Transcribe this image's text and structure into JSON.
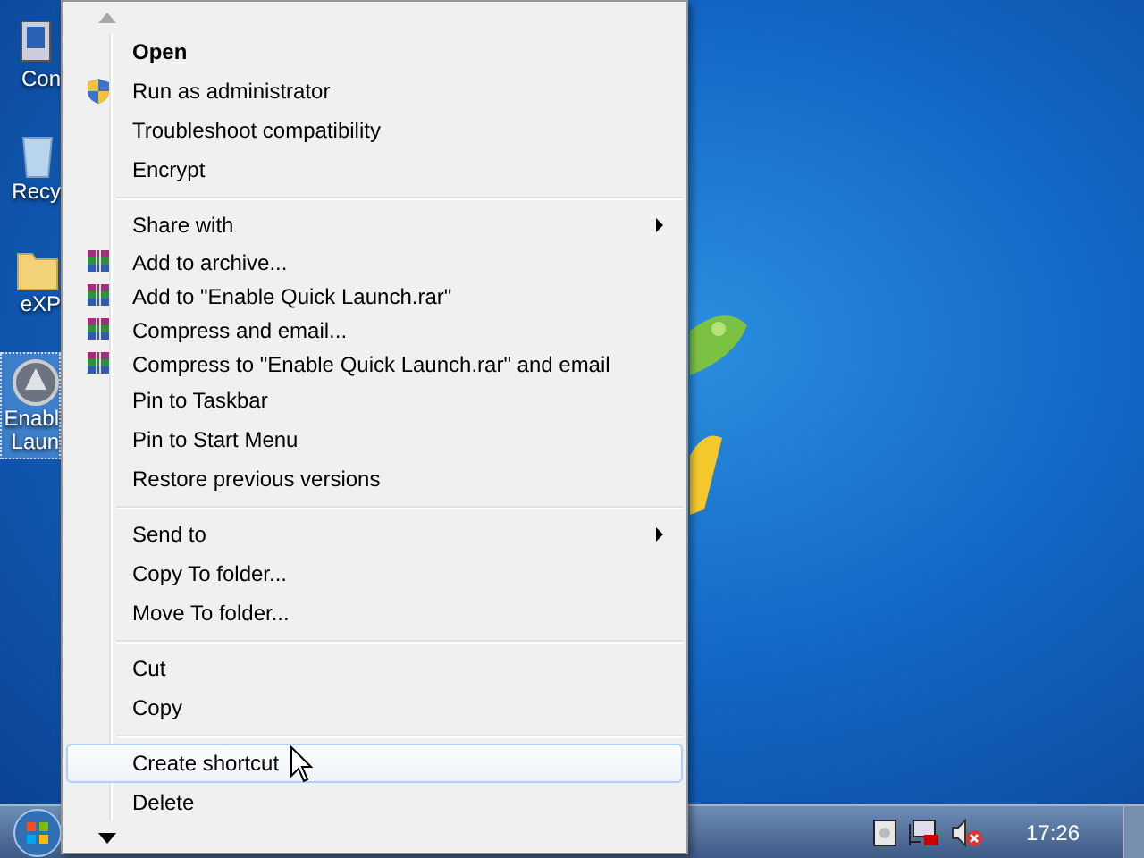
{
  "desktop": {
    "icons": [
      {
        "kind": "computer",
        "lines": [
          "Con"
        ],
        "selected": false
      },
      {
        "kind": "recycle",
        "lines": [
          "Recy"
        ],
        "selected": false
      },
      {
        "kind": "folder",
        "lines": [
          "eXP"
        ],
        "selected": false
      },
      {
        "kind": "app",
        "lines": [
          "Enabl",
          "Laun"
        ],
        "selected": true
      }
    ]
  },
  "context_menu": {
    "scroll_up": {
      "disabled": true
    },
    "scroll_down": {
      "disabled": false
    },
    "items": [
      {
        "kind": "default",
        "label": "Open",
        "selected": false
      },
      {
        "kind": "shield",
        "label": "Run as administrator",
        "selected": false
      },
      {
        "kind": "plain",
        "label": "Troubleshoot compatibility",
        "selected": false
      },
      {
        "kind": "plain",
        "label": "Encrypt",
        "selected": false
      },
      {
        "kind": "separator"
      },
      {
        "kind": "submenu",
        "label": "Share with",
        "selected": false
      },
      {
        "kind": "archive",
        "label": "Add to archive...",
        "selected": false
      },
      {
        "kind": "archive",
        "label": "Add to \"Enable Quick Launch.rar\"",
        "selected": false
      },
      {
        "kind": "archive",
        "label": "Compress and email...",
        "selected": false
      },
      {
        "kind": "archive",
        "label": "Compress to \"Enable Quick Launch.rar\" and email",
        "selected": false
      },
      {
        "kind": "plain",
        "label": "Pin to Taskbar",
        "selected": false
      },
      {
        "kind": "plain",
        "label": "Pin to Start Menu",
        "selected": false
      },
      {
        "kind": "plain",
        "label": "Restore previous versions",
        "selected": false
      },
      {
        "kind": "separator"
      },
      {
        "kind": "submenu",
        "label": "Send to",
        "selected": false
      },
      {
        "kind": "plain",
        "label": "Copy To folder...",
        "selected": false
      },
      {
        "kind": "plain",
        "label": "Move To folder...",
        "selected": false
      },
      {
        "kind": "separator"
      },
      {
        "kind": "plain",
        "label": "Cut",
        "selected": false
      },
      {
        "kind": "plain",
        "label": "Copy",
        "selected": false
      },
      {
        "kind": "separator"
      },
      {
        "kind": "plain",
        "label": "Create shortcut",
        "selected": true
      },
      {
        "kind": "plain",
        "label": "Delete",
        "selected": false
      }
    ]
  },
  "taskbar": {
    "clock": "17:26"
  }
}
